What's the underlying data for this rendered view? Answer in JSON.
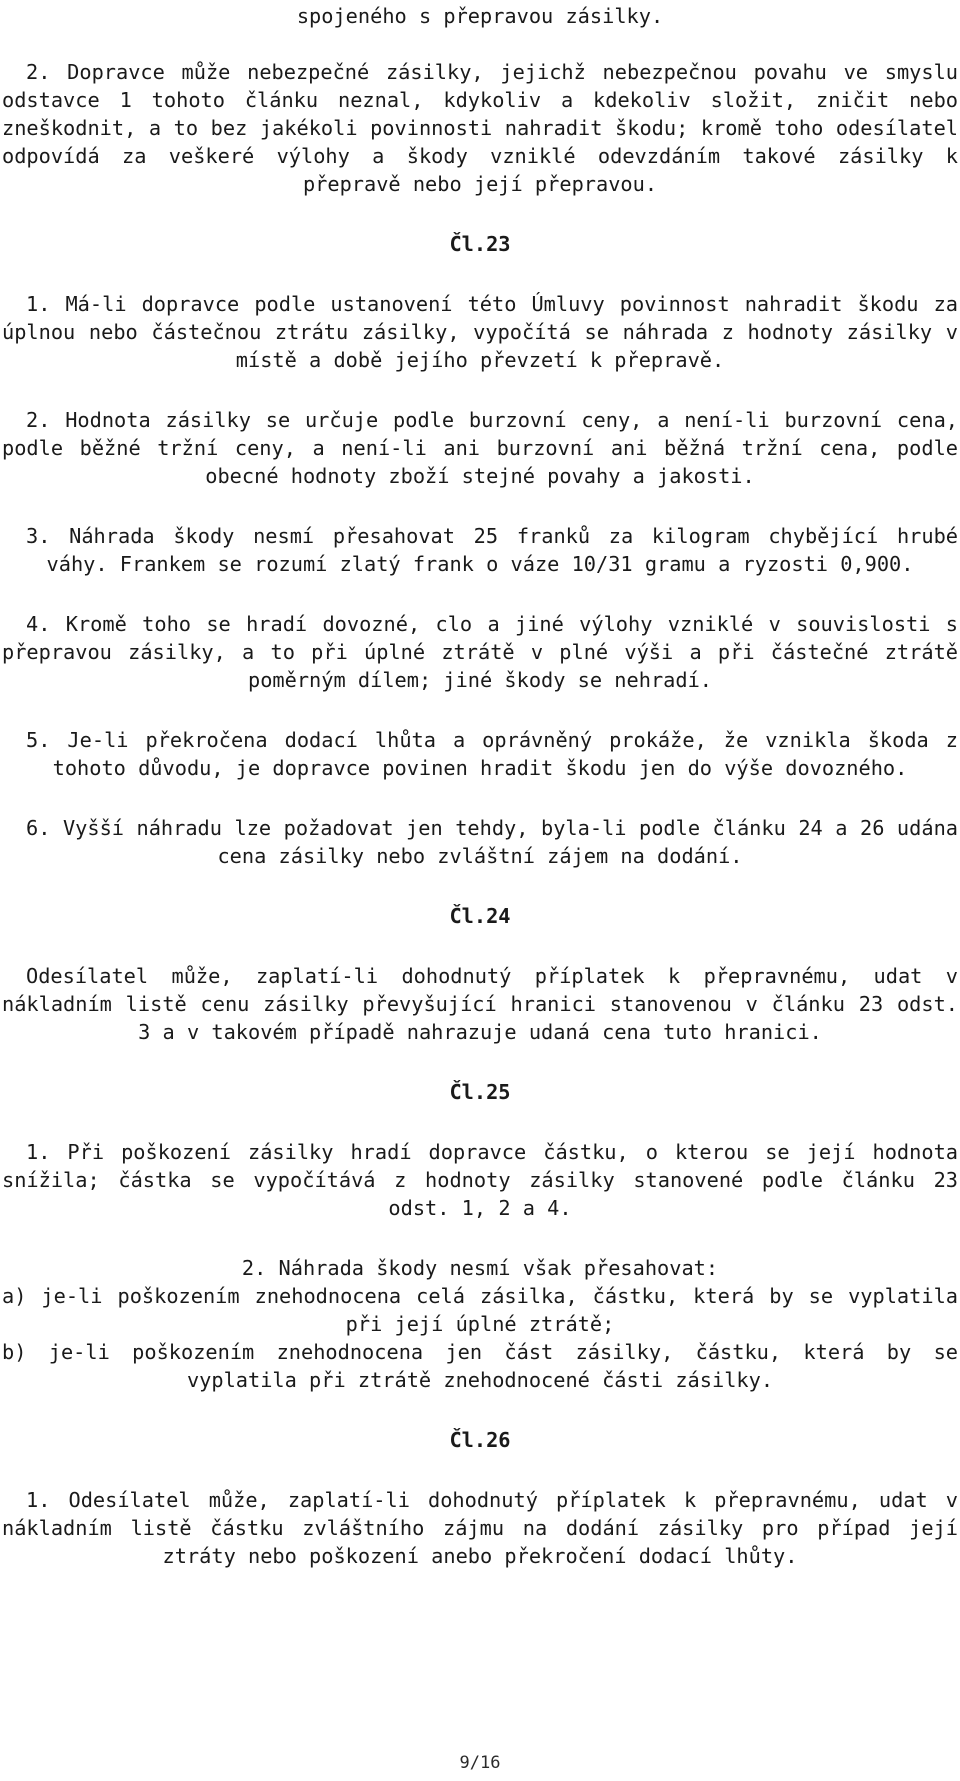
{
  "document": {
    "language": "cs",
    "page_footer": "9/16",
    "background_color": "#ffffff",
    "text_color": "#1a1a1a"
  },
  "blocks": {
    "intro_tail": "spojeného s přepravou zásilky.",
    "art22_para2": "2. Dopravce může nebezpečné zásilky, jejichž nebezpečnou povahu ve smyslu odstavce 1 tohoto článku neznal, kdykoliv a kdekoliv složit, zničit nebo zneškodnit, a to bez jakékoli povinnosti nahradit škodu; kromě toho odesílatel odpovídá za veškeré výlohy a škody vzniklé odevzdáním takové zásilky k přepravě nebo její přepravou.",
    "heading_23": "Čl.23",
    "art23_para1": "1. Má-li dopravce podle ustanovení této Úmluvy povinnost nahradit škodu za úplnou nebo částečnou ztrátu zásilky, vypočítá se náhrada z hodnoty zásilky v místě a době jejího převzetí k přepravě.",
    "art23_para2": "2. Hodnota zásilky se určuje podle burzovní ceny, a není-li burzovní cena, podle běžné tržní ceny, a není-li ani burzovní ani běžná tržní cena, podle obecné hodnoty zboží stejné povahy a jakosti.",
    "art23_para3": "3. Náhrada škody nesmí přesahovat 25 franků za kilogram chybějící hrubé váhy. Frankem se rozumí zlatý frank o váze 10/31 gramu a ryzosti 0,900.",
    "art23_para4": "4. Kromě toho se hradí dovozné, clo a jiné výlohy vzniklé v souvislosti s přepravou zásilky, a to při úplné ztrátě v plné výši a při částečné ztrátě poměrným dílem; jiné škody se nehradí.",
    "art23_para5": "5. Je-li překročena dodací lhůta a oprávněný prokáže, že vznikla škoda z tohoto důvodu, je dopravce povinen hradit škodu jen do výše dovozného.",
    "art23_para6": "6. Vyšší náhradu lze požadovat jen tehdy, byla-li podle článku 24 a 26 udána cena zásilky nebo zvláštní zájem na dodání.",
    "heading_24": "Čl.24",
    "art24_body": "Odesílatel může, zaplatí-li dohodnutý příplatek k přepravnému, udat v nákladním listě cenu zásilky převyšující hranici stanovenou v článku 23 odst. 3 a v takovém případě nahrazuje udaná cena tuto hranici.",
    "heading_25": "Čl.25",
    "art25_para1": "1. Při poškození zásilky hradí dopravce částku, o kterou se její hodnota snížila; částka se vypočítává z hodnoty zásilky stanovené podle článku 23 odst. 1, 2 a 4.",
    "art25_para2_lead": "2. Náhrada škody nesmí však přesahovat:",
    "art25_para2_a": "a) je-li poškozením znehodnocena celá zásilka, částku, která by se vyplatila při její úplné ztrátě;",
    "art25_para2_b": "b) je-li poškozením znehodnocena jen část zásilky, částku, která by se vyplatila při ztrátě znehodnocené části zásilky.",
    "heading_26": "Čl.26",
    "art26_para1": "1. Odesílatel může, zaplatí-li dohodnutý příplatek k přepravnému, udat v nákladním listě částku zvláštního zájmu na dodání zásilky pro případ její ztráty nebo poškození anebo překročení dodací lhůty."
  }
}
